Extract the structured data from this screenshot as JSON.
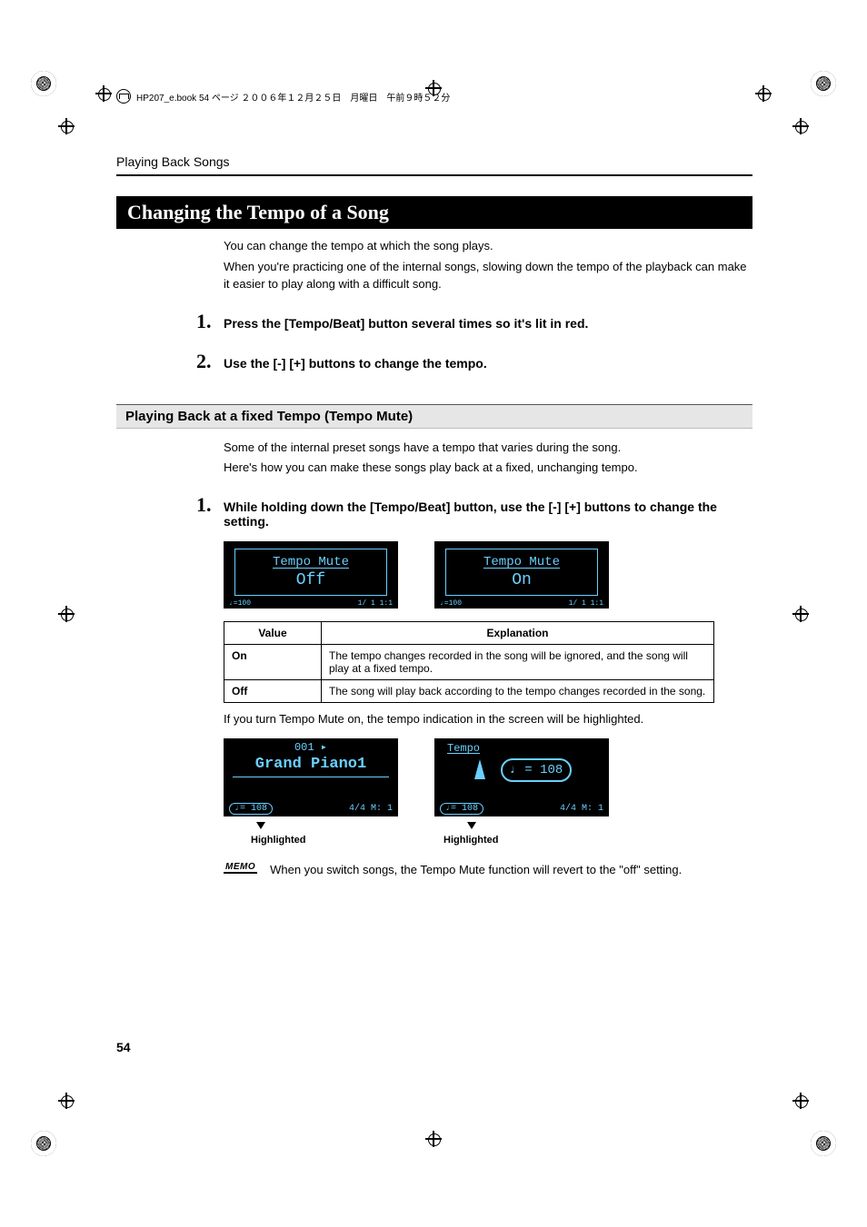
{
  "header_line": "HP207_e.book  54 ページ  ２００６年１２月２５日　月曜日　午前９時５２分",
  "section_path": "Playing Back Songs",
  "main_heading": "Changing the Tempo of a Song",
  "intro_p1": "You can change the tempo at which the song plays.",
  "intro_p2": "When you're practicing one of the internal songs, slowing down the tempo of the playback can make it easier to play along with a difficult song.",
  "steps_a": [
    {
      "num": "1.",
      "text": "Press the [Tempo/Beat] button several times so it's lit in red."
    },
    {
      "num": "2.",
      "text": "Use the [-] [+] buttons to change the tempo."
    }
  ],
  "sub_heading": "Playing Back at a fixed Tempo (Tempo Mute)",
  "sub_p1": "Some of the internal preset songs have a tempo that varies during the song.",
  "sub_p2": "Here's how you can make these songs play back at a fixed, unchanging tempo.",
  "steps_b": [
    {
      "num": "1.",
      "text": "While holding down the [Tempo/Beat] button, use the [-] [+] buttons to change the setting."
    }
  ],
  "lcd_title": "Tempo Mute",
  "lcd_off": "Off",
  "lcd_on": "On",
  "lcd_foot_l": "♩=100",
  "lcd_foot_r": "1/ 1  1:1",
  "table": {
    "head_value": "Value",
    "head_expl": "Explanation",
    "rows": [
      {
        "value": "On",
        "expl": "The tempo changes recorded in the song will be ignored, and the song will play at a fixed tempo."
      },
      {
        "value": "Off",
        "expl": "The song will play back according to the tempo changes recorded in the song."
      }
    ]
  },
  "after_table": "If you turn Tempo Mute on, the tempo indication in the screen will be highlighted.",
  "lcd2a": {
    "line1": "001 ▸",
    "line2": "Grand Piano1",
    "badge": "♩= 108",
    "right": "4/4  M:   1"
  },
  "lcd2b": {
    "hdr": "Tempo",
    "circle": "♩ = 108",
    "badge": "♩= 108",
    "right": "4/4  M:   1"
  },
  "highlighted": "Highlighted",
  "memo_label": "MEMO",
  "memo_text": "When you switch songs, the Tempo Mute function will revert to the \"off\" setting.",
  "page_number": "54"
}
